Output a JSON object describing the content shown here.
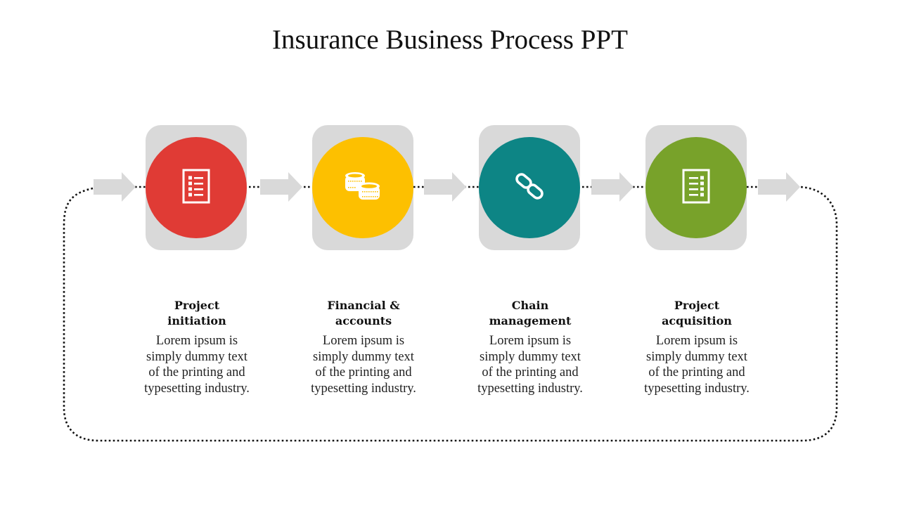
{
  "title": "Insurance Business Process PPT",
  "colors": {
    "step_bg": "#d9d9d9",
    "arrow": "#d9d9d9",
    "connector": "#111111"
  },
  "steps": [
    {
      "heading": "Project initiation",
      "heading_lines": [
        "Project",
        "initiation"
      ],
      "body": "Lorem ipsum is simply dummy text of the printing and typesetting industry.",
      "color": "#e03b35",
      "icon": "checklist-icon"
    },
    {
      "heading": "Financial & accounts",
      "heading_lines": [
        "Financial &",
        "accounts"
      ],
      "body": "Lorem ipsum is simply dummy text of the printing and typesetting industry.",
      "color": "#fdc000",
      "icon": "coins-icon"
    },
    {
      "heading": "Chain management",
      "heading_lines": [
        "Chain",
        "management"
      ],
      "body": "Lorem ipsum is simply dummy text of the printing and typesetting industry.",
      "color": "#0d8585",
      "icon": "chain-link-icon"
    },
    {
      "heading": "Project acquisition",
      "heading_lines": [
        "Project",
        "acquisition"
      ],
      "body": "Lorem ipsum is simply dummy text of the printing and typesetting industry.",
      "color": "#78a22a",
      "icon": "checklist-icon"
    }
  ]
}
